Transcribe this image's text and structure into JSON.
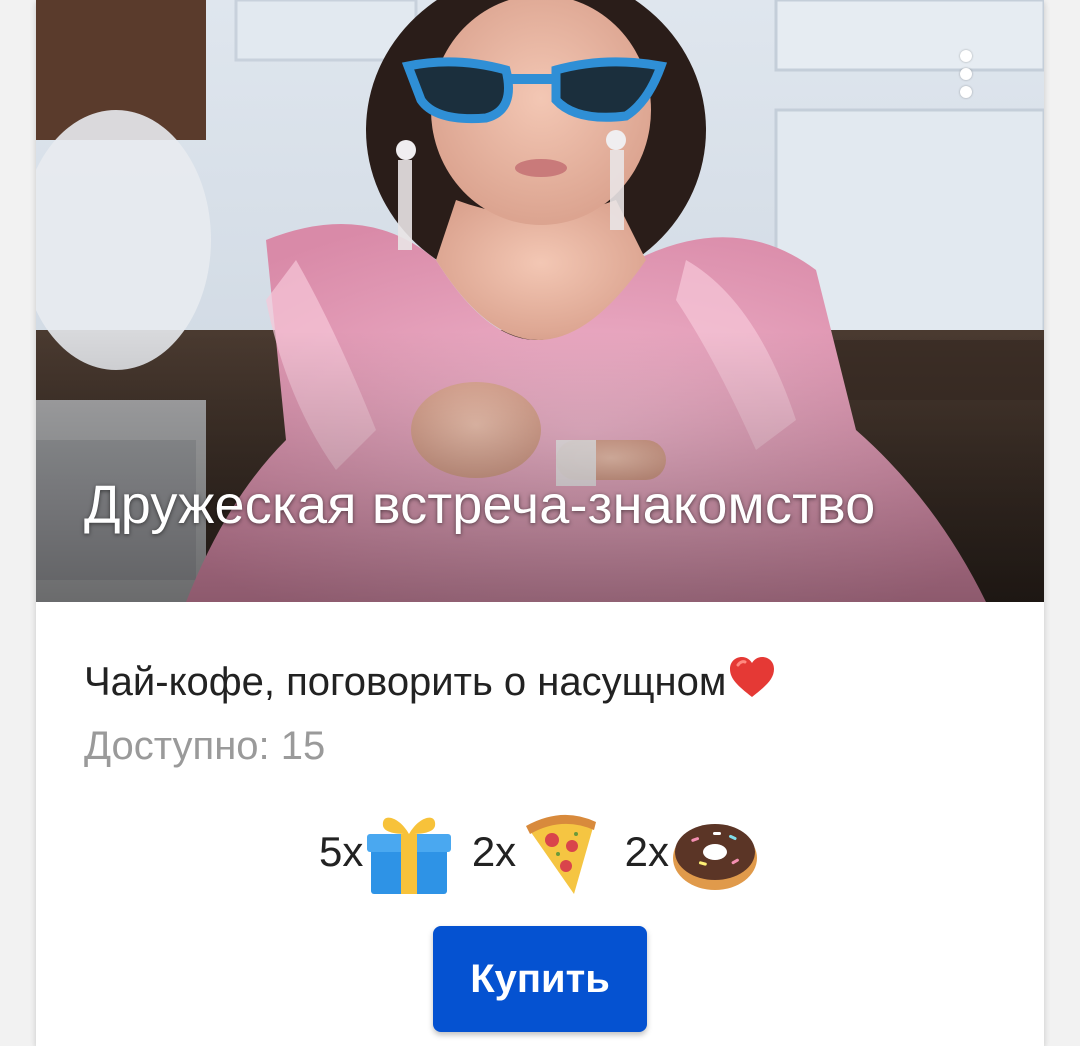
{
  "card": {
    "title": "Дружеская встреча-знакомство",
    "description": "Чай-кофе, поговорить о насущном",
    "description_emoji": "heart-icon",
    "available_text": "Доступно: 15",
    "prices": [
      {
        "qty": "5x",
        "icon": "gift-icon"
      },
      {
        "qty": "2x",
        "icon": "pizza-icon"
      },
      {
        "qty": "2x",
        "icon": "donut-icon"
      }
    ],
    "buy_label": "Купить"
  },
  "colors": {
    "accent": "#0552d1",
    "muted_text": "#9a9a9a",
    "dress_pink": "#e9a7bf",
    "sunglasses": "#2f8fd6"
  }
}
